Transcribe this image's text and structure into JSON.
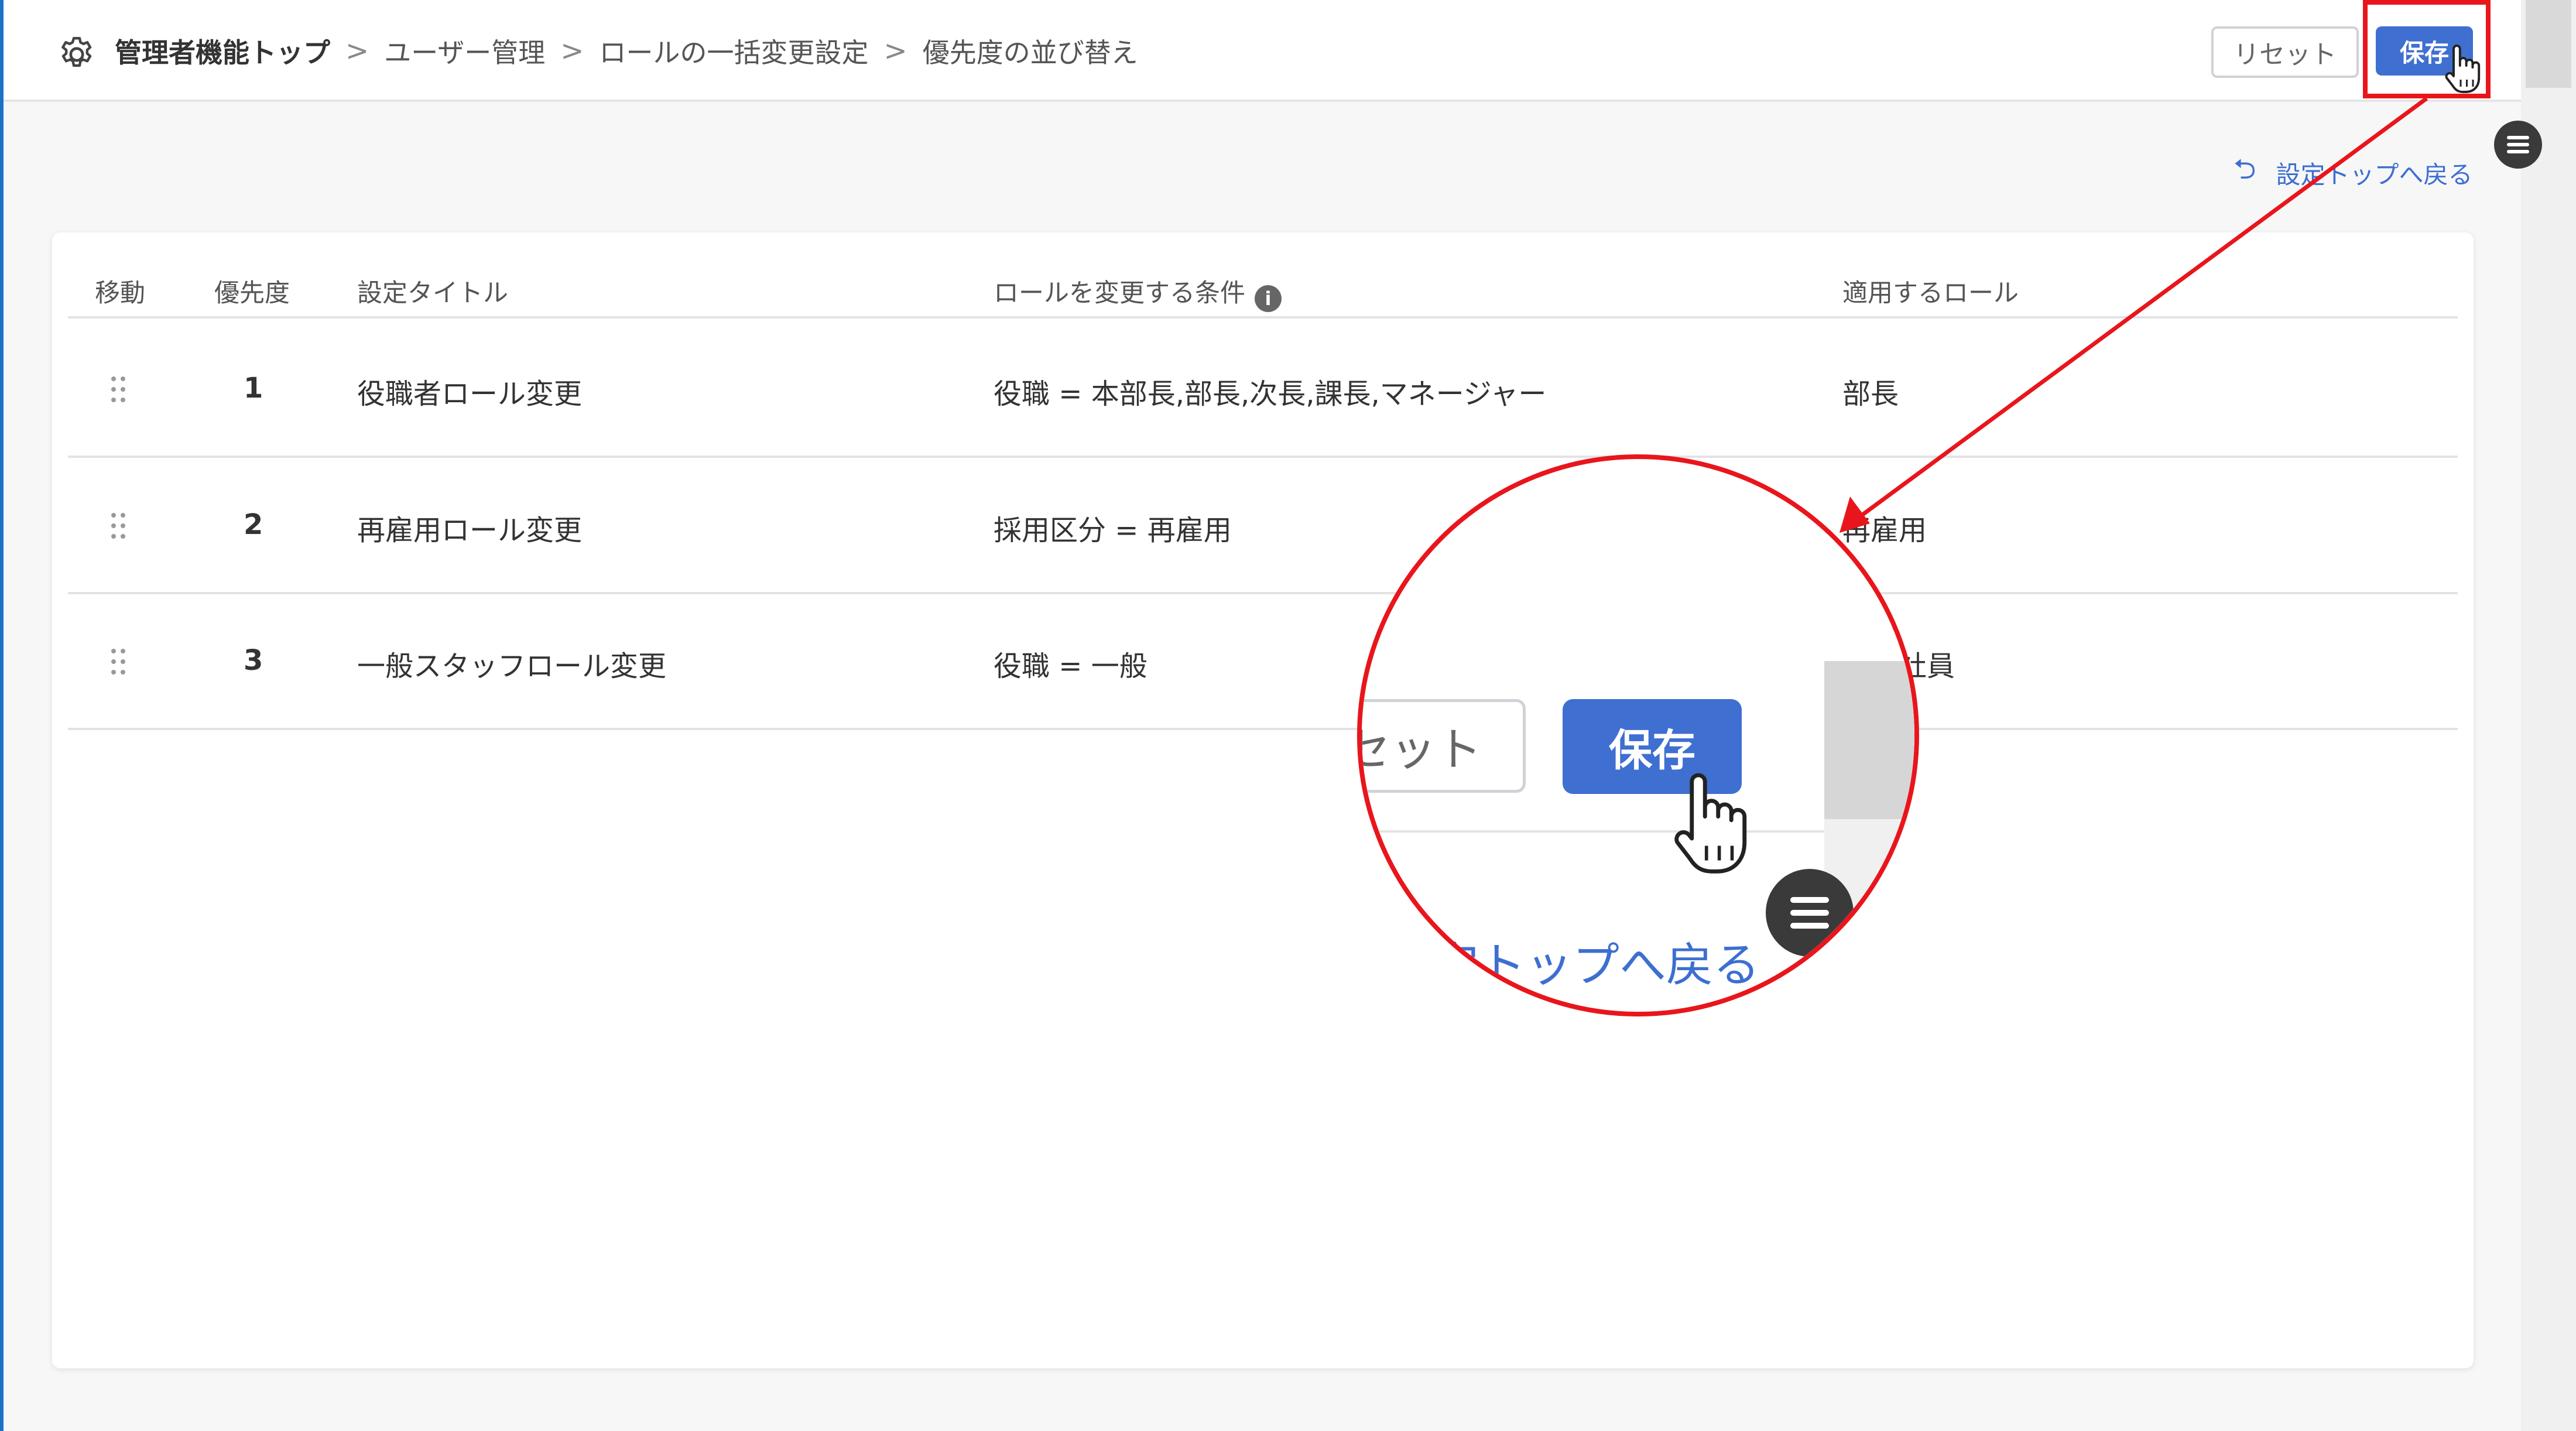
{
  "breadcrumb": {
    "home": "管理者機能トップ",
    "items": [
      "ユーザー管理",
      "ロールの一括変更設定",
      "優先度の並び替え"
    ],
    "separator": ">"
  },
  "header": {
    "reset_label": "リセット",
    "save_label": "保存"
  },
  "back_link": {
    "arrow": "⮌",
    "label": "設定トップへ戻る"
  },
  "table": {
    "columns": {
      "move": "移動",
      "priority": "優先度",
      "title": "設定タイトル",
      "condition": "ロールを変更する条件",
      "role": "適用するロール"
    },
    "info_glyph": "i",
    "rows": [
      {
        "priority": "1",
        "title": "役職者ロール変更",
        "condition": "役職 = 本部長,部長,次長,課長,マネージャー",
        "role": "部長"
      },
      {
        "priority": "2",
        "title": "再雇用ロール変更",
        "condition": "採用区分 = 再雇用",
        "role": "再雇用"
      },
      {
        "priority": "3",
        "title": "一般スタッフロール変更",
        "condition": "役職 = 一般",
        "role": "一般社員"
      }
    ]
  },
  "zoom": {
    "reset_fragment": "セット",
    "save_label": "保存",
    "link_fragment": "定トップへ戻る"
  },
  "colors": {
    "accent": "#3f6fd0",
    "highlight": "#e8161c",
    "link": "#3d6fd0"
  },
  "icons": [
    "gear-icon",
    "drag-handle-icon",
    "info-icon",
    "back-arrow-icon",
    "menu-icon",
    "hand-cursor-icon"
  ]
}
